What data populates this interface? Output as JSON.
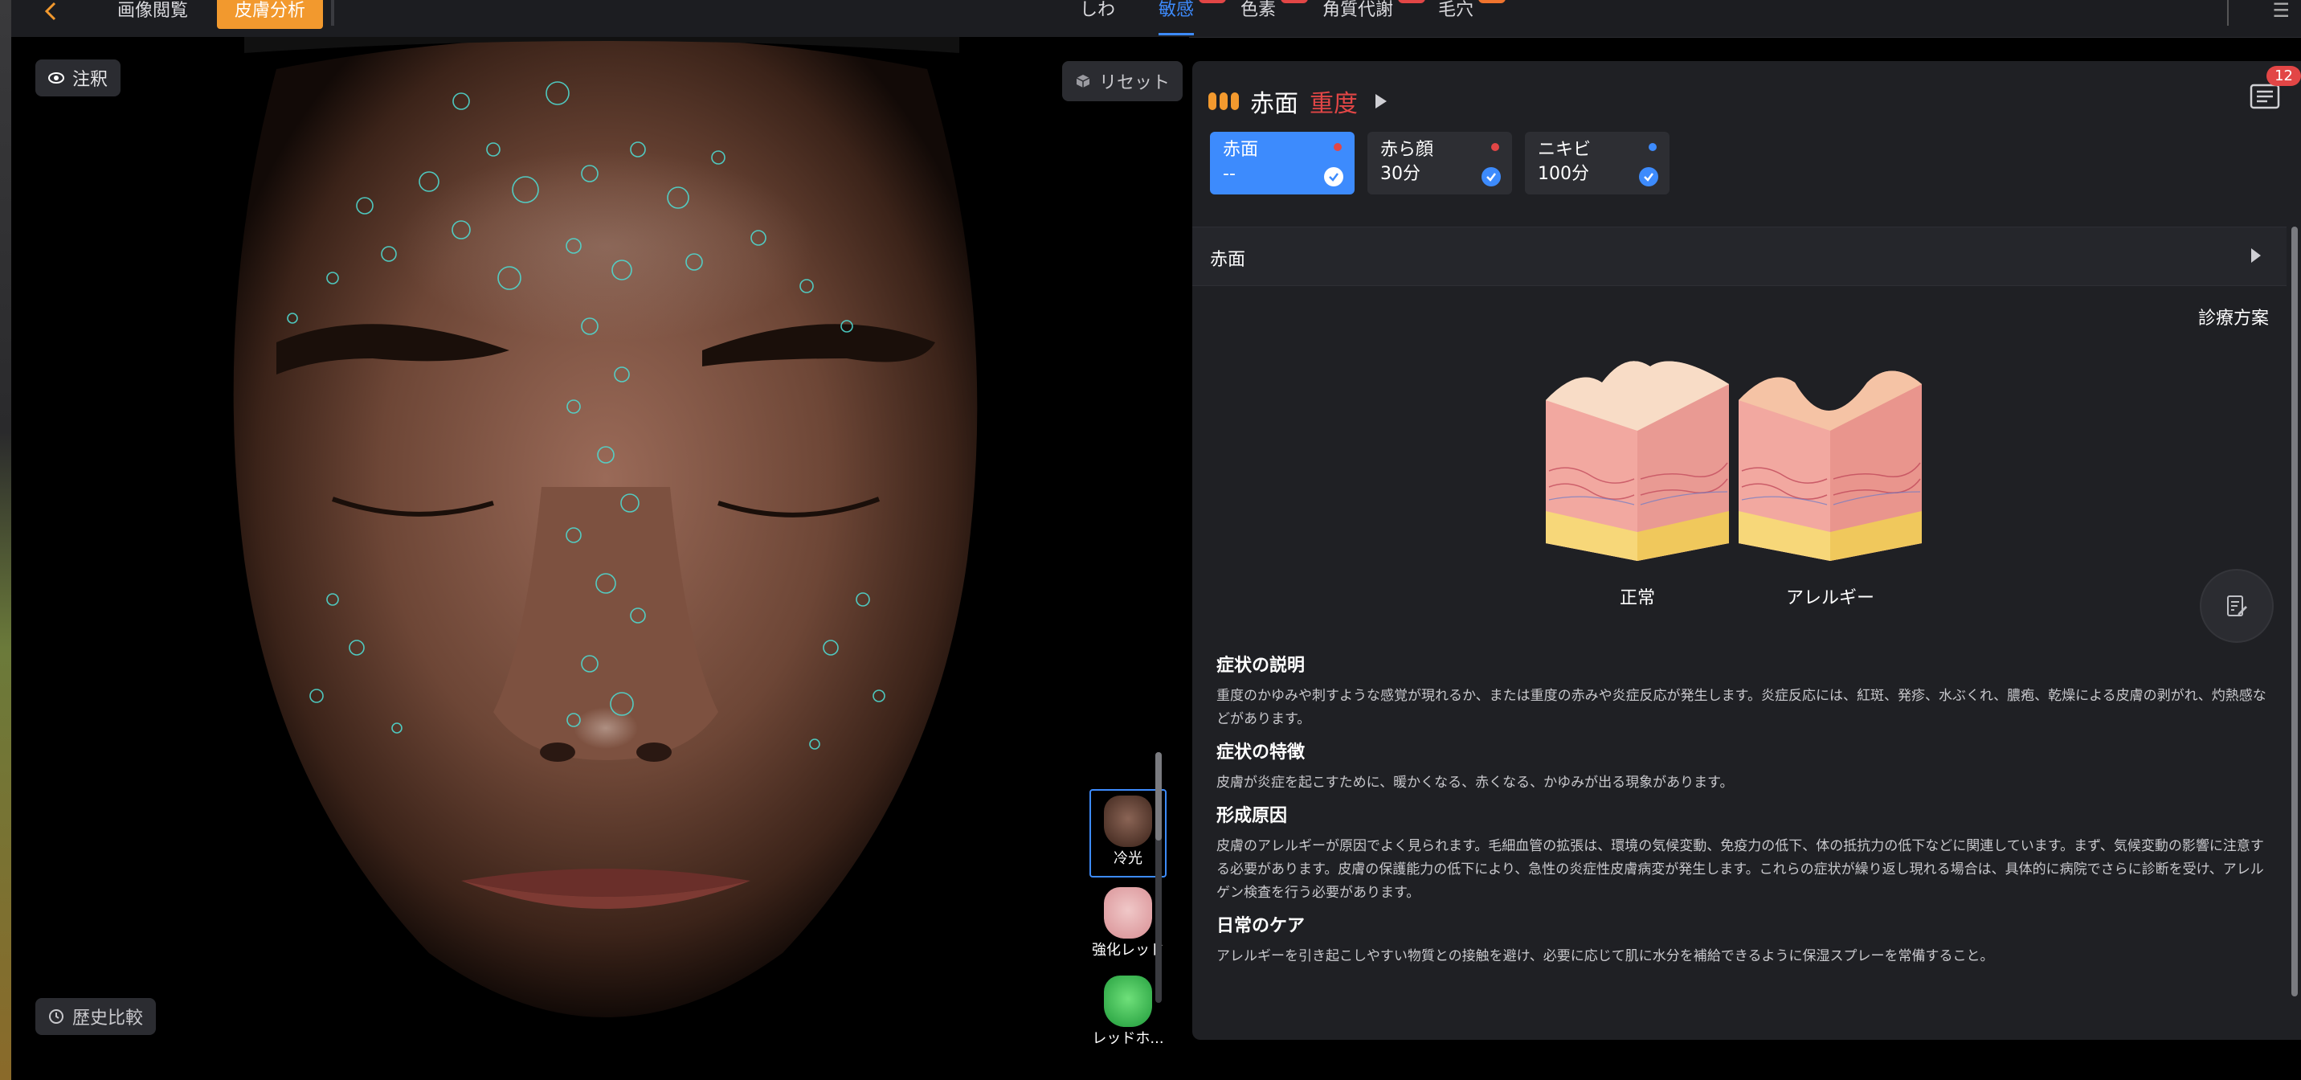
{
  "topbar": {
    "back_label": "<",
    "tabs": [
      {
        "label": "画像閲覧"
      },
      {
        "label": "皮膚分析"
      }
    ],
    "categories": [
      {
        "label": "しわ"
      },
      {
        "label": "敏感"
      },
      {
        "label": "色素"
      },
      {
        "label": "角質代謝"
      },
      {
        "label": "毛穴"
      }
    ]
  },
  "photo": {
    "annotation_label": "注釈",
    "reset_label": "リセット",
    "history_label": "歴史比較",
    "thumbnails": [
      {
        "label": "冷光"
      },
      {
        "label": "強化レッド"
      },
      {
        "label": "レッドホ..."
      }
    ]
  },
  "panel": {
    "title": "赤面",
    "severity": "重度",
    "list_badge": "12",
    "chips": [
      {
        "name": "赤面",
        "value": "--",
        "dot_color": "#e24646"
      },
      {
        "name": "赤ら顔",
        "value": "30分",
        "dot_color": "#e24646"
      },
      {
        "name": "ニキビ",
        "value": "100分",
        "dot_color": "#3d8bfd"
      }
    ],
    "section_title": "赤面",
    "plan_label": "診療方案",
    "illustrations": [
      {
        "label": "正常"
      },
      {
        "label": "アレルギー"
      }
    ],
    "sections": [
      {
        "heading": "症状の説明",
        "text": "重度のかゆみや刺すような感覚が現れるか、または重度の赤みや炎症反応が発生します。炎症反応には、紅斑、発疹、水ぶくれ、膿疱、乾燥による皮膚の剥がれ、灼熱感などがあります。"
      },
      {
        "heading": "症状の特徴",
        "text": "皮膚が炎症を起こすために、暖かくなる、赤くなる、かゆみが出る現象があります。"
      },
      {
        "heading": "形成原因",
        "text": "皮膚のアレルギーが原因でよく見られます。毛細血管の拡張は、環境の気候変動、免疫力の低下、体の抵抗力の低下などに関連しています。まず、気候変動の影響に注意する必要があります。皮膚の保護能力の低下により、急性の炎症性皮膚病変が発生します。これらの症状が繰り返し現れる場合は、具体的に病院でさらに診断を受け、アレルゲン検査を行う必要があります。"
      },
      {
        "heading": "日常のケア",
        "text": "アレルギーを引き起こしやすい物質との接触を避け、必要に応じて肌に水分を補給できるように保湿スプレーを常備すること。"
      }
    ]
  },
  "colors": {
    "accent_orange": "#f2992e",
    "accent_blue": "#3d8bfd",
    "severity_red": "#e24646"
  }
}
